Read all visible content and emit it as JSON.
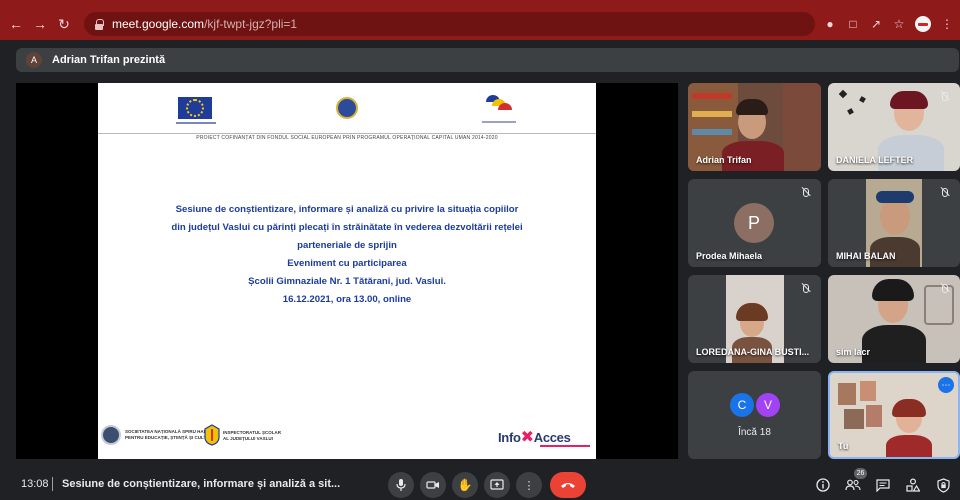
{
  "browser": {
    "url_host": "meet.google.com",
    "url_path": "/kjf-twpt-jgz?pli=1"
  },
  "presentation_banner": {
    "avatar_letter": "A",
    "text": "Adrian Trifan prezintă"
  },
  "slide": {
    "funding_line": "PROIECT COFINANȚAT DIN FONDUL SOCIAL EUROPEAN PRIN PROGRAMUL OPERAȚIONAL CAPITAL UMAN 2014-2020",
    "title_lines": [
      "Sesiune de conștientizare, informare și analiză cu privire la situația copiilor",
      "din județul Vaslui cu părinți plecați în străinătate în vederea dezvoltării rețelei",
      "parteneriale de sprijin",
      "Eveniment cu participarea",
      "Școlii Gimnaziale Nr. 1 Tătărani, jud. Vaslui.",
      "16.12.2021, ora 13.00, online"
    ],
    "footer_left": "SOCIETATEA NAȚIONALĂ SPIRU HARET\nPENTRU EDUCAȚIE, ȘTIINȚĂ ȘI CULTURĂ",
    "footer_mid": "INSPECTORATUL ȘCOLAR\nAL JUDEȚULUI VASLUI",
    "logo_info": "Info",
    "logo_acces": "Acces"
  },
  "participants": [
    {
      "name": "Adrian Trifan"
    },
    {
      "name": "DANIELA LEFTER"
    },
    {
      "name": "Prodea Mihaela",
      "avatar_letter": "P"
    },
    {
      "name": "MIHAI BALAN"
    },
    {
      "name": "LOREDANA-GINA BUSTI..."
    },
    {
      "name": "sim lacr"
    },
    {
      "name": "Încă 18",
      "avatar_letters": [
        "C",
        "V"
      ]
    },
    {
      "name": "Tu"
    }
  ],
  "bottom_bar": {
    "time": "13:08",
    "meeting_title": "Sesiune de conștientizare, informare și analiză a sit...",
    "participant_count": "26"
  },
  "colors": {
    "chrome": "#8e1a1a",
    "meet_bg": "#202124",
    "end_call": "#ea4335",
    "slide_title": "#1b3c9e",
    "avatar_p": "#8d6e63",
    "avatar_c": "#1a73e8",
    "avatar_v": "#a142f4"
  }
}
